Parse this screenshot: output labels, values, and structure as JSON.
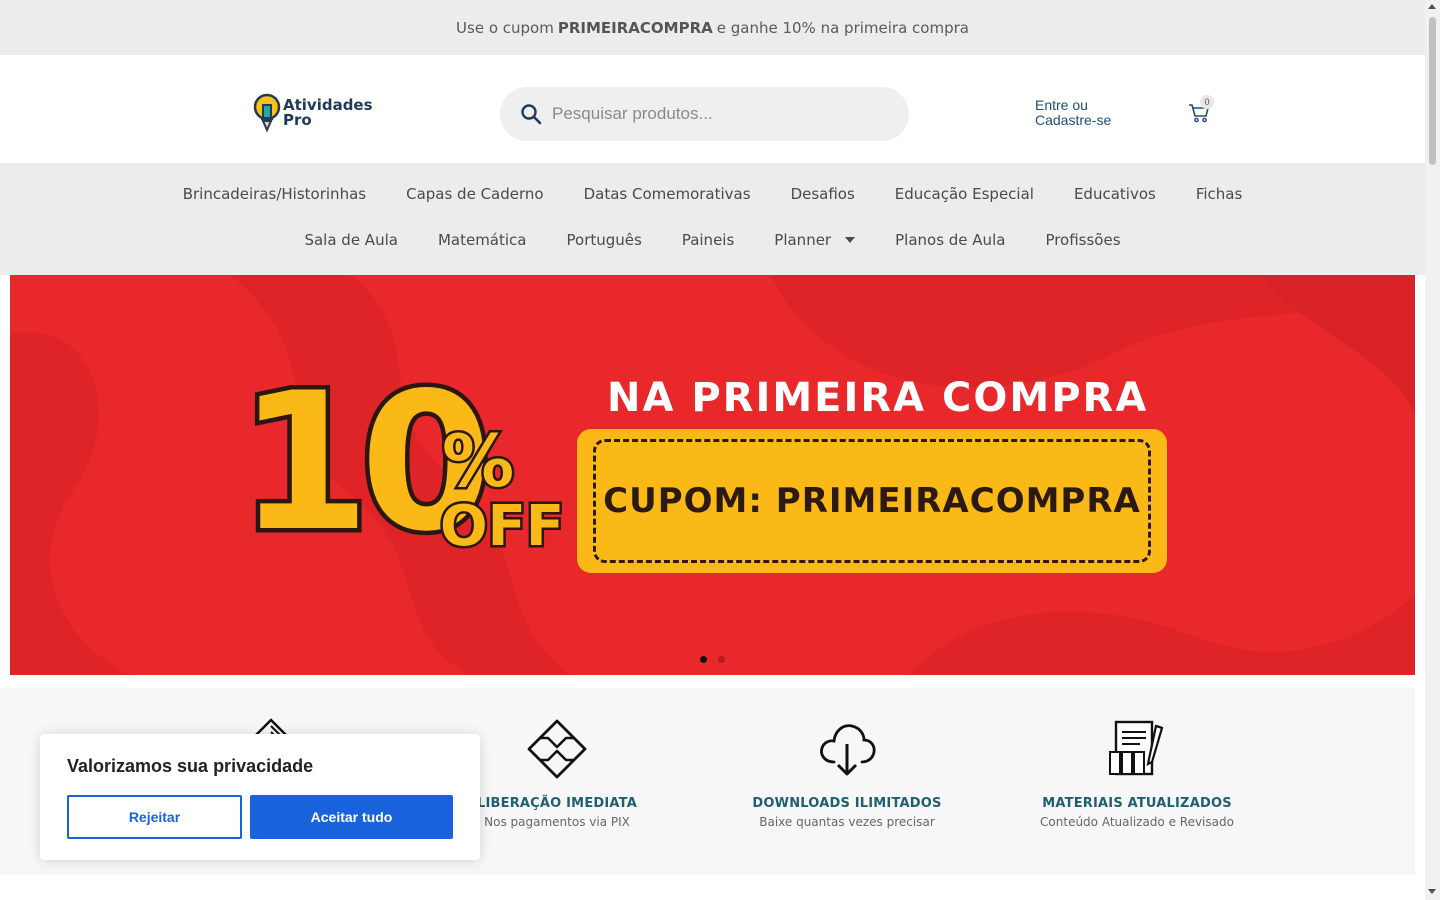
{
  "announcement": {
    "prefix": "Use o cupom",
    "code": "PRIMEIRACOMPRA",
    "suffix": "e ganhe 10% na primeira compra"
  },
  "header": {
    "logo_line1": "Atividades",
    "logo_line2": "Pro",
    "search_placeholder": "Pesquisar produtos...",
    "login_line1": "Entre ou",
    "login_line2": "Cadastre-se",
    "cart_count": "0"
  },
  "nav": {
    "row1": [
      "Brincadeiras/Historinhas",
      "Capas de Caderno",
      "Datas Comemorativas",
      "Desafios",
      "Educação Especial",
      "Educativos",
      "Fichas"
    ],
    "row2": [
      "Sala de Aula",
      "Matemática",
      "Português",
      "Paineis",
      "Planner",
      "Planos de Aula",
      "Profissões"
    ]
  },
  "hero": {
    "headline": "NA PRIMEIRA COMPRA",
    "coupon": "CUPOM: PRIMEIRACOMPRA",
    "big_number": "10",
    "percent": "%",
    "off": "OFF",
    "slides_total": 2,
    "active_slide": 1,
    "bg_color": "#e8282b",
    "accent_color": "#fbb917"
  },
  "features": [
    {
      "icon": "tag-icon",
      "title": "",
      "subtitle": ""
    },
    {
      "icon": "pix-icon",
      "title": "LIBERAÇÃO IMEDIATA",
      "subtitle": "Nos pagamentos via PIX"
    },
    {
      "icon": "cloud-download-icon",
      "title": "DOWNLOADS ILIMITADOS",
      "subtitle": "Baixe quantas vezes precisar"
    },
    {
      "icon": "documents-icon",
      "title": "MATERIAIS ATUALIZADOS",
      "subtitle": "Conteúdo Atualizado e Revisado"
    }
  ],
  "cookie": {
    "title": "Valorizamos sua privacidade",
    "reject_label": "Rejeitar",
    "accept_label": "Aceitar tudo",
    "accent_color": "#1863dc"
  }
}
